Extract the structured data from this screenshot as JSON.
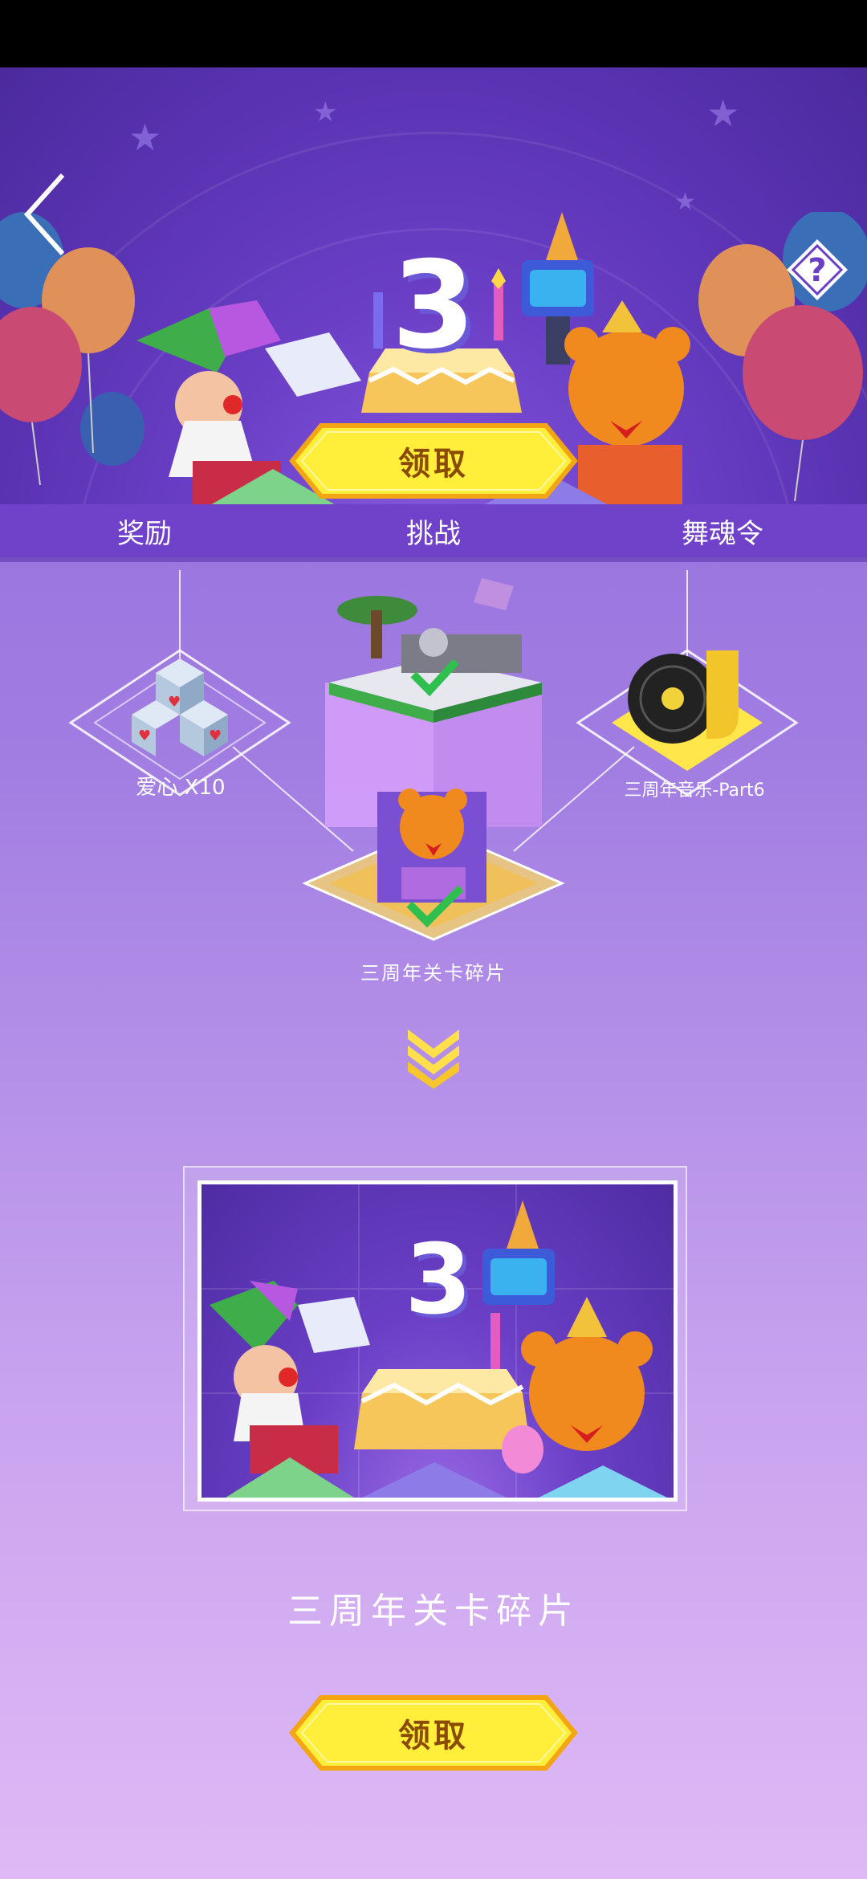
{
  "header": {
    "claim_label": "领取",
    "back_icon": "chevron-left-icon",
    "help_icon": "help-diamond-icon"
  },
  "hero_badge": "3",
  "tabs": [
    {
      "label": "奖励"
    },
    {
      "label": "挑战"
    },
    {
      "label": "舞魂令"
    }
  ],
  "rewards": {
    "left_label": "爱心 X10",
    "right_label": "三周年音乐-Part6",
    "center_label": "三周年关卡碎片"
  },
  "preview": {
    "title": "三周年关卡碎片",
    "badge": "3"
  },
  "footer": {
    "claim_label": "领取"
  },
  "colors": {
    "accent_yellow": "#ffee3a",
    "button_text": "#8a4b00",
    "tab_bar": "#6f42c9",
    "check_green": "#2fbf4e"
  }
}
